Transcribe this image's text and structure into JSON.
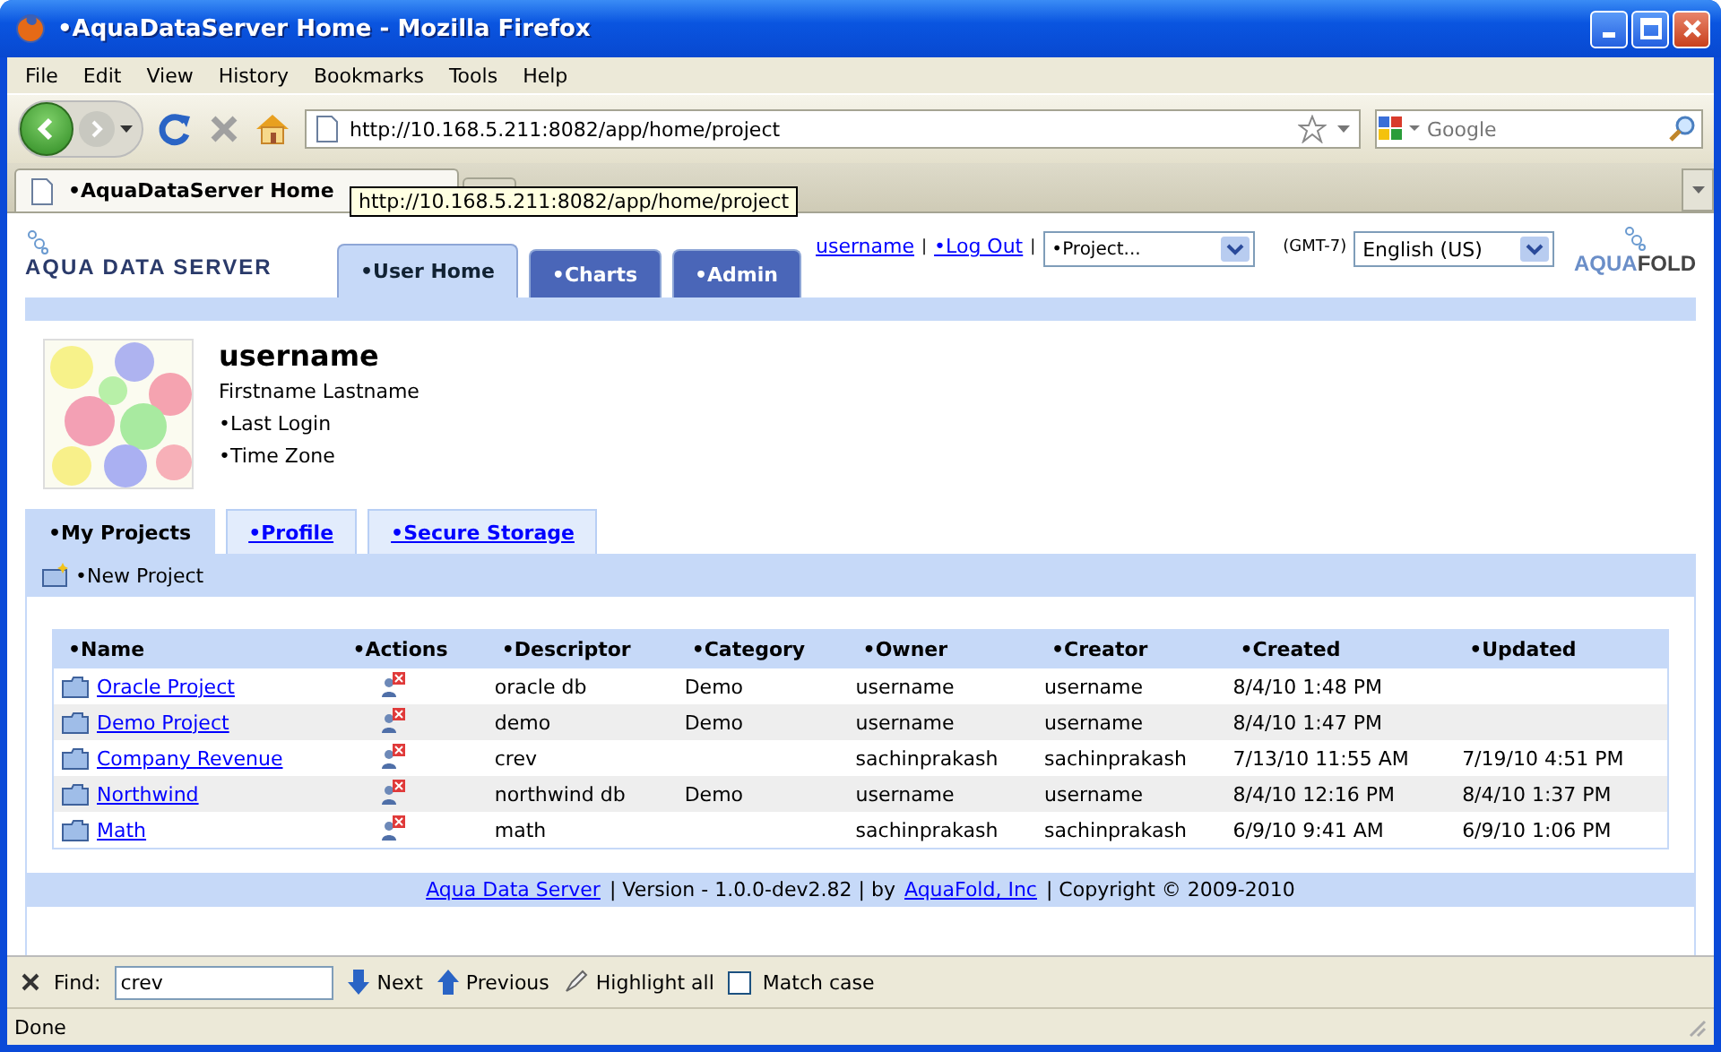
{
  "window": {
    "title": "•AquaDataServer Home - Mozilla Firefox"
  },
  "menu": [
    "File",
    "Edit",
    "View",
    "History",
    "Bookmarks",
    "Tools",
    "Help"
  ],
  "address_bar": {
    "url": "http://10.168.5.211:8082/app/home/project"
  },
  "search": {
    "placeholder": "Google"
  },
  "browser_tabs": [
    {
      "label": "•AquaDataServer Home",
      "selected": true
    }
  ],
  "tooltip": "http://10.168.5.211:8082/app/home/project",
  "app": {
    "logo": "AQUA DATA SERVER",
    "nav_tabs": [
      {
        "label": "•User Home",
        "selected": true
      },
      {
        "label": "•Charts",
        "selected": false
      },
      {
        "label": "•Admin",
        "selected": false
      }
    ],
    "links": [
      "username",
      "•Log Out"
    ],
    "separator": "|",
    "project_select": "•Project...",
    "timezone": "(GMT-7)",
    "language_select": "English (US)",
    "brand": {
      "first": "AQUA",
      "second": "FOLD"
    },
    "profile": {
      "name": "username",
      "full_name": "Firstname Lastname",
      "last_login": "•Last Login",
      "time_zone": "•Time Zone"
    },
    "sub_tabs": [
      {
        "label": "•My Projects",
        "selected": true
      },
      {
        "label": "•Profile",
        "selected": false
      },
      {
        "label": "•Secure Storage",
        "selected": false
      }
    ],
    "new_project": "•New Project",
    "table": {
      "columns": [
        "•Name",
        "•Actions",
        "•Descriptor",
        "•Category",
        "•Owner",
        "•Creator",
        "•Created",
        "•Updated"
      ],
      "rows": [
        {
          "name": "Oracle Project",
          "descriptor": "oracle db",
          "category": "Demo",
          "owner": "username",
          "creator": "username",
          "created": "8/4/10 1:48 PM",
          "updated": ""
        },
        {
          "name": "Demo Project",
          "descriptor": "demo",
          "category": "Demo",
          "owner": "username",
          "creator": "username",
          "created": "8/4/10 1:47 PM",
          "updated": ""
        },
        {
          "name": "Company Revenue",
          "descriptor": "crev",
          "category": "",
          "owner": "sachinprakash",
          "creator": "sachinprakash",
          "created": "7/13/10 11:55 AM",
          "updated": "7/19/10 4:51 PM"
        },
        {
          "name": "Northwind",
          "descriptor": "northwind db",
          "category": "Demo",
          "owner": "username",
          "creator": "username",
          "created": "8/4/10 12:16 PM",
          "updated": "8/4/10 1:37 PM"
        },
        {
          "name": "Math",
          "descriptor": "math",
          "category": "",
          "owner": "sachinprakash",
          "creator": "sachinprakash",
          "created": "6/9/10 9:41 AM",
          "updated": "6/9/10 1:06 PM"
        }
      ]
    },
    "footer": [
      {
        "kind": "link",
        "text": "Aqua Data Server"
      },
      {
        "kind": "text",
        "text": "| Version - 1.0.0-dev2.82 | by"
      },
      {
        "kind": "link",
        "text": "AquaFold, Inc"
      },
      {
        "kind": "text",
        "text": "| Copyright © 2009-2010"
      }
    ]
  },
  "find_bar": {
    "label": "Find:",
    "value": "crev",
    "next": "Next",
    "previous": "Previous",
    "highlight": "Highlight all",
    "match_case": {
      "label": "Match case",
      "checked": false
    }
  },
  "status_bar": "Done"
}
